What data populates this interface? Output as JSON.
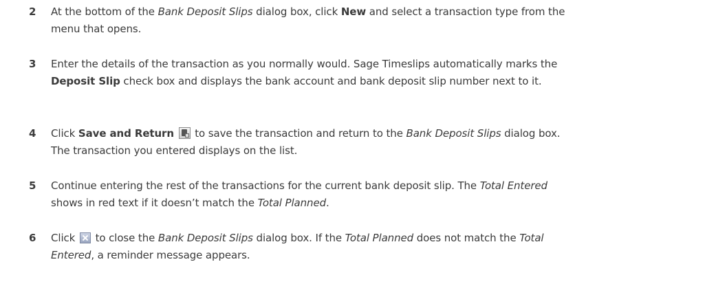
{
  "steps": [
    {
      "number": "2",
      "segments": {
        "s1": "At the bottom of the ",
        "s2": "Bank Deposit Slips",
        "s3": " dialog box, click ",
        "s4": "New",
        "s5": " and select a transaction type from the menu that opens."
      }
    },
    {
      "number": "3",
      "segments": {
        "s1": "Enter the details of the transaction as you normally would. Sage Timeslips automatically marks the ",
        "s2": "Deposit Slip",
        "s3": " check box and displays the bank account and bank deposit slip number next to it."
      }
    },
    {
      "number": "4",
      "segments": {
        "s1": "Click ",
        "s2": "Save and Return",
        "s3": " to save the transaction and return to the ",
        "s4": "Bank Deposit Slips",
        "s5": " dialog box. The transaction you entered displays on the list."
      },
      "icon": "save-and-return-icon"
    },
    {
      "number": "5",
      "segments": {
        "s1": "Continue entering the rest of the transactions for the current bank deposit slip. The ",
        "s2": "Total Entered",
        "s3": " shows in red text if it doesn’t match the ",
        "s4": "Total Planned",
        "s5": "."
      }
    },
    {
      "number": "6",
      "segments": {
        "s1": "Click ",
        "s2": " to close the ",
        "s3": "Bank Deposit Slips",
        "s4": " dialog box. If the ",
        "s5": "Total Planned",
        "s6": " does not match the ",
        "s7": "Total Entered",
        "s8": ", a reminder message appears."
      },
      "icon": "close-icon"
    }
  ]
}
